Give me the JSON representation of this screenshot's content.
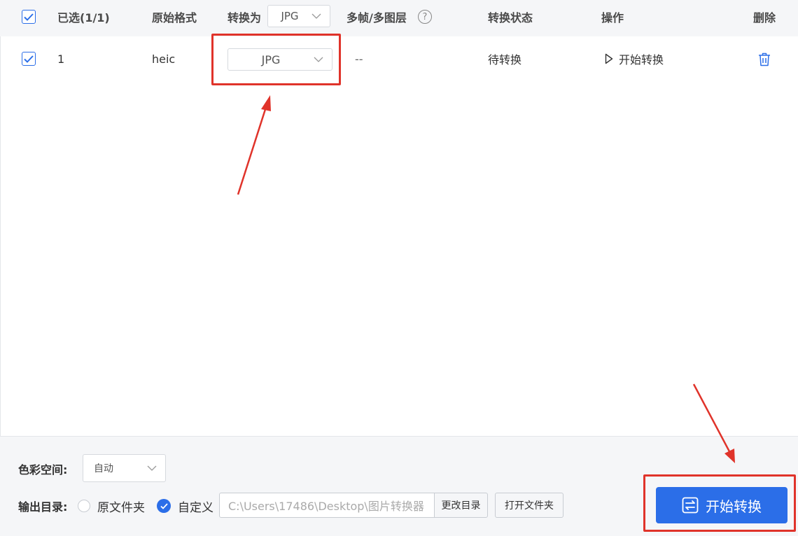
{
  "header": {
    "selected_label": "已选(1/1)",
    "original_format": "原始格式",
    "convert_to": "转换为",
    "convert_to_value": "JPG",
    "multiframe": "多帧/多图层",
    "help_glyph": "?",
    "status": "转换状态",
    "action": "操作",
    "delete": "删除"
  },
  "rows": [
    {
      "index": "1",
      "format": "heic",
      "target": "JPG",
      "multiframe": "--",
      "status": "待转换",
      "action_label": "开始转换"
    }
  ],
  "footer": {
    "color_space_label": "色彩空间:",
    "color_space_value": "自动",
    "output_dir_label": "输出目录:",
    "original_folder": "原文件夹",
    "custom": "自定义",
    "path_value": "C:\\Users\\17486\\Desktop\\图片转换器",
    "change_dir": "更改目录",
    "open_folder": "打开文件夹",
    "start_button": "开始转换"
  },
  "colors": {
    "accent": "#2b6ee8",
    "annotation_red": "#e0332a"
  }
}
